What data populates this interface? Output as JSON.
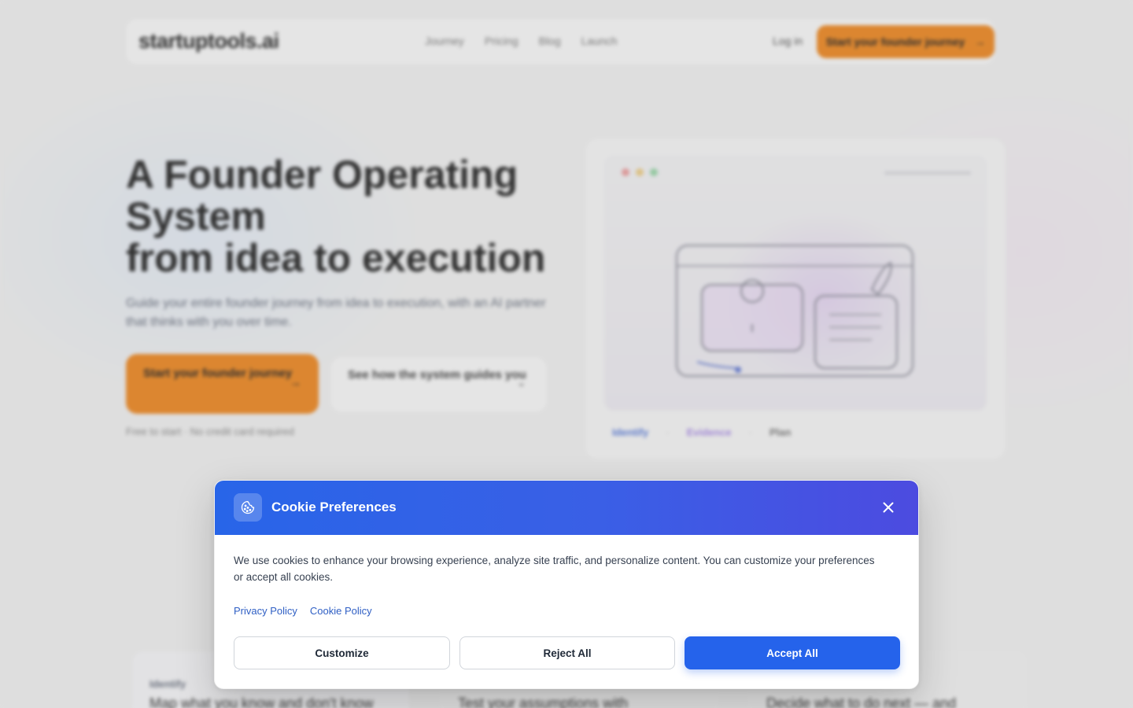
{
  "background": {
    "nav": {
      "logo": "startuptools.ai",
      "links": [
        "Journey",
        "Pricing",
        "Blog",
        "Launch"
      ],
      "login": "Log in",
      "cta": "Start your founder journey",
      "cta_icon": "arrow-right-icon"
    },
    "hero": {
      "title_line1": "A Founder Operating",
      "title_line2": "System",
      "title_line3": "from idea to execution",
      "subtitle": "Guide your entire founder journey from idea to execution, with an AI partner that thinks with you over time.",
      "primary_cta": "Start your founder journey",
      "secondary_cta": "See how the system guides you",
      "note": "Free to start · No credit card required"
    },
    "visual": {
      "steps": [
        "Identify",
        "Evidence",
        "Plan"
      ]
    },
    "cards": [
      {
        "tag": "Identify",
        "heading": "Map what you know and don't know"
      },
      {
        "tag": "",
        "heading": "Test your assumptions with"
      },
      {
        "tag": "",
        "heading": "Decide what to do next — and"
      }
    ]
  },
  "cookie_dialog": {
    "title": "Cookie Preferences",
    "icon": "cookie-icon",
    "close_icon": "close-icon",
    "body": "We use cookies to enhance your browsing experience, analyze site traffic, and personalize content. You can customize your preferences or accept all cookies.",
    "links": [
      "Privacy Policy",
      "Cookie Policy"
    ],
    "buttons": {
      "customize": "Customize",
      "reject": "Reject All",
      "accept": "Accept All"
    },
    "colors": {
      "header_start": "#2865e8",
      "header_end": "#4c4be0",
      "accept": "#2563eb",
      "link": "#2f5fc4"
    }
  }
}
